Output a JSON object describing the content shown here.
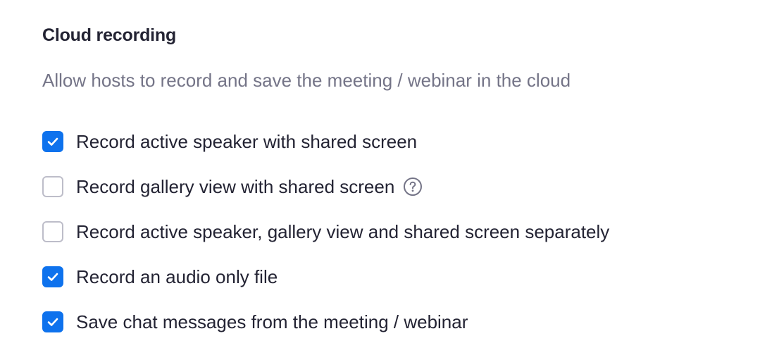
{
  "section": {
    "title": "Cloud recording",
    "description": "Allow hosts to record and save the meeting / webinar in the cloud"
  },
  "options": [
    {
      "label": "Record active speaker with shared screen",
      "checked": true
    },
    {
      "label": "Record gallery view with shared screen",
      "checked": false,
      "help_icon": "question-circle-icon"
    },
    {
      "label": "Record active speaker, gallery view and shared screen separately",
      "checked": false
    },
    {
      "label": "Record an audio only file",
      "checked": true
    },
    {
      "label": "Save chat messages from the meeting / webinar",
      "checked": true
    }
  ],
  "colors": {
    "checkbox_checked": "#0e72ed",
    "checkbox_border": "#bdbdc9",
    "title_text": "#232333",
    "description_text": "#747487"
  }
}
